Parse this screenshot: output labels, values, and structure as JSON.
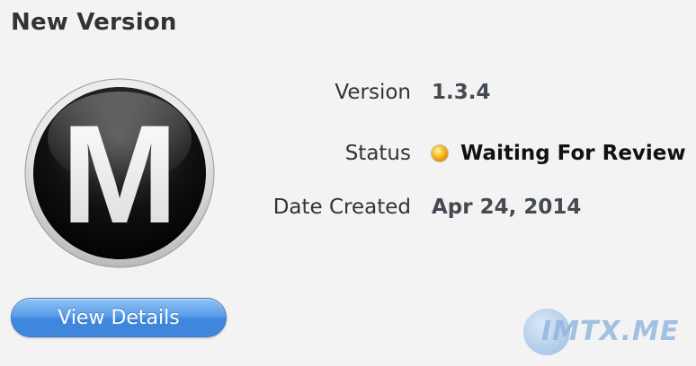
{
  "header": {
    "title": "New Version"
  },
  "app": {
    "icon_name": "app-logo-m-icon",
    "icon_letter": "M"
  },
  "details": {
    "version_label": "Version",
    "version_value": "1.3.4",
    "status_label": "Status",
    "status_value": "Waiting For Review",
    "status_color": "#f0a400",
    "date_label": "Date Created",
    "date_value": "Apr 24, 2014"
  },
  "actions": {
    "view_details_label": "View Details"
  },
  "watermark": {
    "text": "IMTX.ME"
  }
}
